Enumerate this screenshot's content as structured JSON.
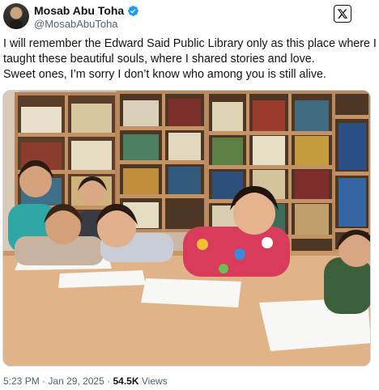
{
  "author": {
    "display_name": "Mosab Abu Toha",
    "handle": "@MosabAbuToha",
    "verified": true
  },
  "tweet": {
    "lines": [
      "I will remember the Edward Said Public Library only as this place where I",
      "taught these beautiful souls, where I shared stories and love.",
      "Sweet ones, I’m sorry I don’t know who among you is still alive."
    ]
  },
  "media": {
    "description_icon": "photo",
    "scene": "children-in-library"
  },
  "footer": {
    "time": "5:23 PM",
    "separator": "·",
    "date": "Jan 29, 2025",
    "views_count": "54.5K",
    "views_label": "Views"
  },
  "colors": {
    "verified": "#1d9bf0",
    "secondary_text": "#536471",
    "primary_text": "#0f1419"
  },
  "icons": {
    "verified": "verified-badge-icon",
    "logo": "x-logo-icon"
  }
}
